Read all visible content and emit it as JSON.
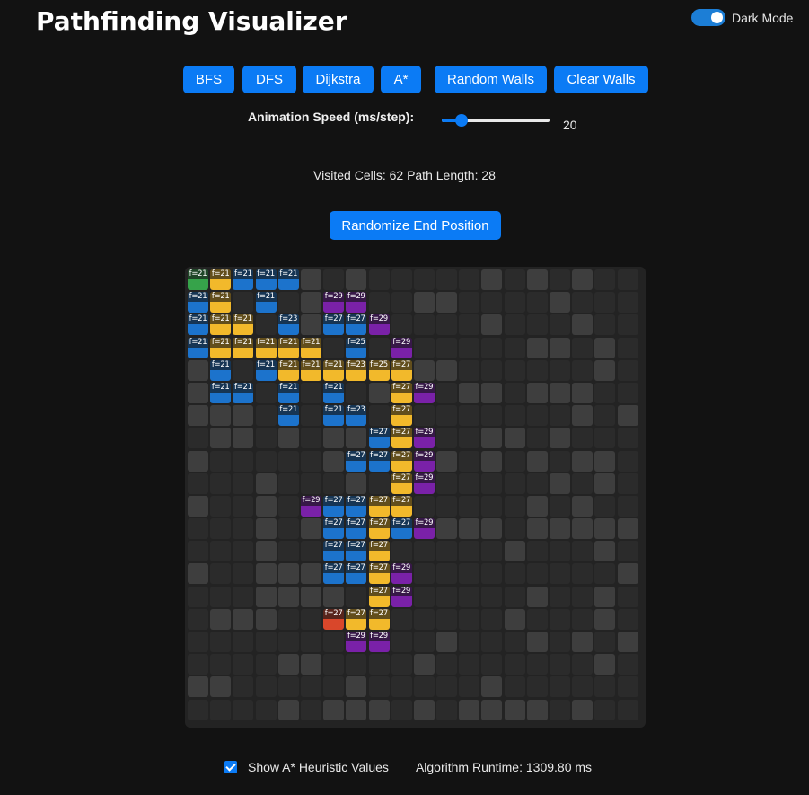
{
  "app": {
    "title": "Pathfinding Visualizer"
  },
  "dark_mode": {
    "label": "Dark Mode",
    "enabled": true
  },
  "toolbar": {
    "buttons": [
      {
        "id": "bfs",
        "label": "BFS"
      },
      {
        "id": "dfs",
        "label": "DFS"
      },
      {
        "id": "dijkstra",
        "label": "Dijkstra"
      },
      {
        "id": "astar",
        "label": "A*"
      },
      {
        "id": "random-walls",
        "label": "Random Walls"
      },
      {
        "id": "clear-walls",
        "label": "Clear Walls"
      }
    ]
  },
  "speed": {
    "label": "Animation Speed (ms/step):",
    "value": "20",
    "fraction": 0.18
  },
  "stats": {
    "text": "Visited Cells: 62  Path Length: 28"
  },
  "randomize_end": {
    "label": "Randomize End Position"
  },
  "grid": {
    "rows": 20,
    "cols": 20,
    "legend": {
      "W": "wall",
      ".": "empty",
      "G": "start",
      "Y": "path",
      "B": "visited",
      "P": "frontier",
      "R": "end"
    },
    "cells": [
      "GYBBBW.W.....W.W.W..",
      "BY.B.WPP..WW....W...",
      "BYY.BWBBP....W...W..",
      "BYYYYY.B.P.....WW.W.",
      "WB.BYYYYYYWW......W.",
      "WBB.B.B.WYP.WW.WWW..",
      "WWW.B.BB.Y.......W.W",
      ".WW.W.WWBYP..WW.W...",
      "W.....WBBYPW.W.W.WW.",
      "...W...W.YP.....W.W.",
      "W..W.PBBYY.....W.W..",
      "...W.WBBYBPWWW.WWWWW",
      "...W..BBY.....W...W.",
      "W..WWWBBYP.........W",
      "...WWWW.YP.....W..W.",
      ".WWW..RYY.....W...W.",
      ".......PP..W...W.W.W",
      "....WW....W.......W.",
      "WW.....W.....W......",
      "....W.WWW.W.WWWW.W.."
    ],
    "fvalues": [
      [
        "f=21",
        "f=21",
        "f=21",
        "f=21",
        "f=21",
        "",
        "",
        "",
        "",
        "",
        "",
        "",
        "",
        "",
        "",
        "",
        "",
        "",
        "",
        ""
      ],
      [
        "f=21",
        "f=21",
        "",
        "f=21",
        "",
        "",
        "f=29",
        "f=29",
        "",
        "",
        "",
        "",
        "",
        "",
        "",
        "",
        "",
        "",
        "",
        ""
      ],
      [
        "f=21",
        "f=21",
        "f=21",
        "",
        "f=23",
        "",
        "f=27",
        "f=27",
        "f=29",
        "",
        "",
        "",
        "",
        "",
        "",
        "",
        "",
        "",
        "",
        ""
      ],
      [
        "f=21",
        "f=21",
        "f=21",
        "f=21",
        "f=21",
        "f=21",
        "",
        "f=25",
        "",
        "f=29",
        "",
        "",
        "",
        "",
        "",
        "",
        "",
        "",
        "",
        ""
      ],
      [
        "",
        "f=21",
        "",
        "f=21",
        "f=21",
        "f=21",
        "f=21",
        "f=23",
        "f=25",
        "f=27",
        "",
        "",
        "",
        "",
        "",
        "",
        "",
        "",
        "",
        ""
      ],
      [
        "",
        "f=21",
        "f=21",
        "",
        "f=21",
        "",
        "f=21",
        "",
        "",
        "f=27",
        "f=29",
        "",
        "",
        "",
        "",
        "",
        "",
        "",
        "",
        ""
      ],
      [
        "",
        "",
        "",
        "",
        "f=21",
        "",
        "f=21",
        "f=23",
        "",
        "f=27",
        "",
        "",
        "",
        "",
        "",
        "",
        "",
        "",
        "",
        ""
      ],
      [
        "",
        "",
        "",
        "",
        "",
        "",
        "",
        "",
        "f=27",
        "f=27",
        "f=29",
        "",
        "",
        "",
        "",
        "",
        "",
        "",
        "",
        ""
      ],
      [
        "",
        "",
        "",
        "",
        "",
        "",
        "",
        "f=27",
        "f=27",
        "f=27",
        "f=29",
        "",
        "",
        "",
        "",
        "",
        "",
        "",
        "",
        ""
      ],
      [
        "",
        "",
        "",
        "",
        "",
        "",
        "",
        "",
        "",
        "f=27",
        "f=29",
        "",
        "",
        "",
        "",
        "",
        "",
        "",
        "",
        ""
      ],
      [
        "",
        "",
        "",
        "",
        "",
        "f=29",
        "f=27",
        "f=27",
        "f=27",
        "f=27",
        "",
        "",
        "",
        "",
        "",
        "",
        "",
        "",
        "",
        ""
      ],
      [
        "",
        "",
        "",
        "",
        "",
        "",
        "f=27",
        "f=27",
        "f=27",
        "f=27",
        "f=29",
        "",
        "",
        "",
        "",
        "",
        "",
        "",
        "",
        ""
      ],
      [
        "",
        "",
        "",
        "",
        "",
        "",
        "f=27",
        "f=27",
        "f=27",
        "",
        "",
        "",
        "",
        "",
        "",
        "",
        "",
        "",
        "",
        ""
      ],
      [
        "",
        "",
        "",
        "",
        "",
        "",
        "f=27",
        "f=27",
        "f=27",
        "f=29",
        "",
        "",
        "",
        "",
        "",
        "",
        "",
        "",
        "",
        ""
      ],
      [
        "",
        "",
        "",
        "",
        "",
        "",
        "",
        "",
        "f=27",
        "f=29",
        "",
        "",
        "",
        "",
        "",
        "",
        "",
        "",
        "",
        ""
      ],
      [
        "",
        "",
        "",
        "",
        "",
        "",
        "f=27",
        "f=27",
        "f=27",
        "",
        "",
        "",
        "",
        "",
        "",
        "",
        "",
        "",
        "",
        ""
      ],
      [
        "",
        "",
        "",
        "",
        "",
        "",
        "",
        "f=29",
        "f=29",
        "",
        "",
        "",
        "",
        "",
        "",
        "",
        "",
        "",
        "",
        ""
      ],
      [
        "",
        "",
        "",
        "",
        "",
        "",
        "",
        "",
        "",
        "",
        "",
        "",
        "",
        "",
        "",
        "",
        "",
        "",
        "",
        ""
      ],
      [
        "",
        "",
        "",
        "",
        "",
        "",
        "",
        "",
        "",
        "",
        "",
        "",
        "",
        "",
        "",
        "",
        "",
        "",
        "",
        ""
      ],
      [
        "",
        "",
        "",
        "",
        "",
        "",
        "",
        "",
        "",
        "",
        "",
        "",
        "",
        "",
        "",
        "",
        "",
        "",
        "",
        ""
      ]
    ]
  },
  "heuristic": {
    "label": "Show A* Heuristic Values",
    "checked": true
  },
  "runtime": {
    "text": "Algorithm Runtime: 1309.80 ms"
  }
}
